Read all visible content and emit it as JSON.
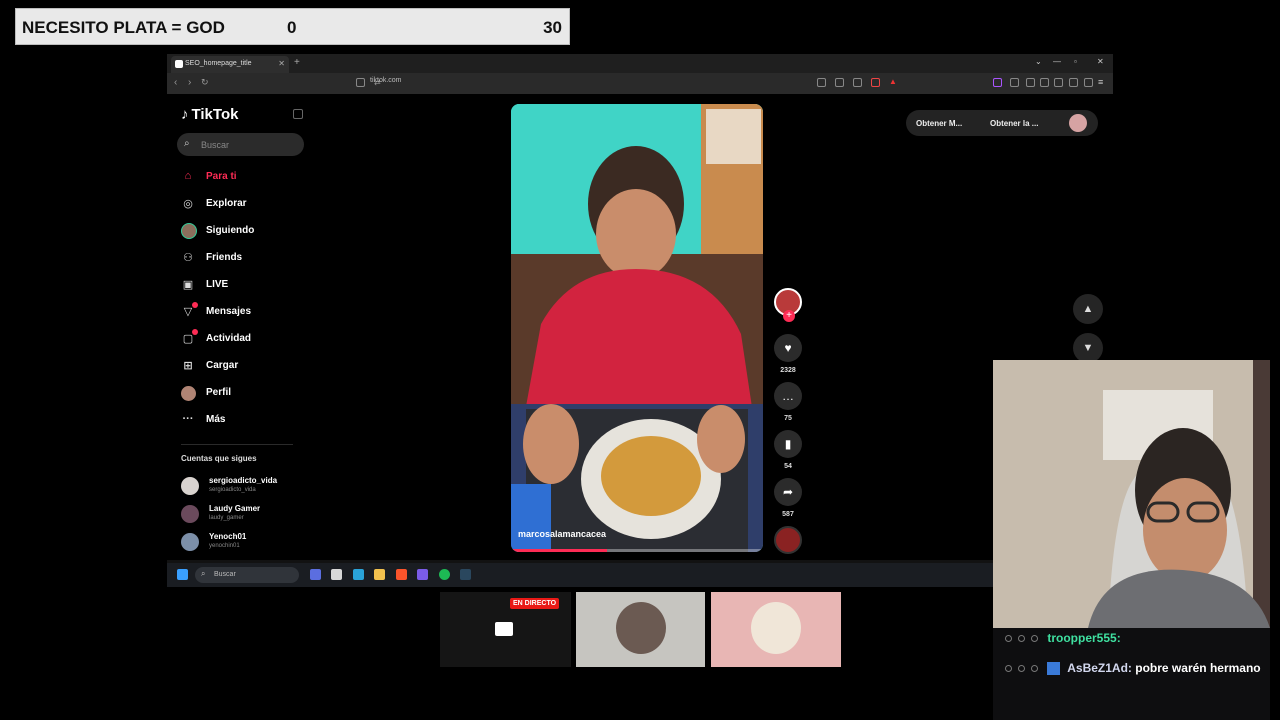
{
  "overlay": {
    "title": "NECESITO PLATA = GOD",
    "current": "0",
    "goal": "30"
  },
  "browser": {
    "tab_title": "SEO_homepage_title",
    "url": "tiktok.com"
  },
  "tiktok": {
    "logo": "TikTok",
    "search_placeholder": "Buscar",
    "nav": [
      {
        "label": "Para ti",
        "icon": "home-icon"
      },
      {
        "label": "Explorar",
        "icon": "compass-icon"
      },
      {
        "label": "Siguiendo",
        "icon": "following-avatar-icon"
      },
      {
        "label": "Friends",
        "icon": "friends-icon"
      },
      {
        "label": "LIVE",
        "icon": "live-tv-icon"
      },
      {
        "label": "Mensajes",
        "icon": "paper-plane-icon"
      },
      {
        "label": "Actividad",
        "icon": "activity-icon"
      },
      {
        "label": "Cargar",
        "icon": "upload-plus-icon"
      },
      {
        "label": "Perfil",
        "icon": "profile-avatar-icon"
      },
      {
        "label": "Más",
        "icon": "more-dots-icon"
      }
    ],
    "following_title": "Cuentas que sigues",
    "following": [
      {
        "name": "sergioadicto_vida",
        "handle": "sergioadicto_vida"
      },
      {
        "name": "Laudy Gamer",
        "handle": "laudy_gamer"
      },
      {
        "name": "Yenoch01",
        "handle": "yenochin01"
      }
    ],
    "video": {
      "author": "marcosalamancacea",
      "likes": "2328",
      "comments": "75",
      "saves": "54",
      "shares": "587",
      "progress": 0.38
    },
    "get_app": "Obtener M...",
    "get_desktop": "Obtener la ..."
  },
  "taskbar": {
    "search_placeholder": "Buscar"
  },
  "stream": {
    "live_badge": "EN DIRECTO"
  },
  "chat": {
    "messages": [
      {
        "user": "troopper555:",
        "text": ""
      },
      {
        "user": "AsBeZ1Ad:",
        "text": "pobre warén hermano"
      }
    ]
  }
}
